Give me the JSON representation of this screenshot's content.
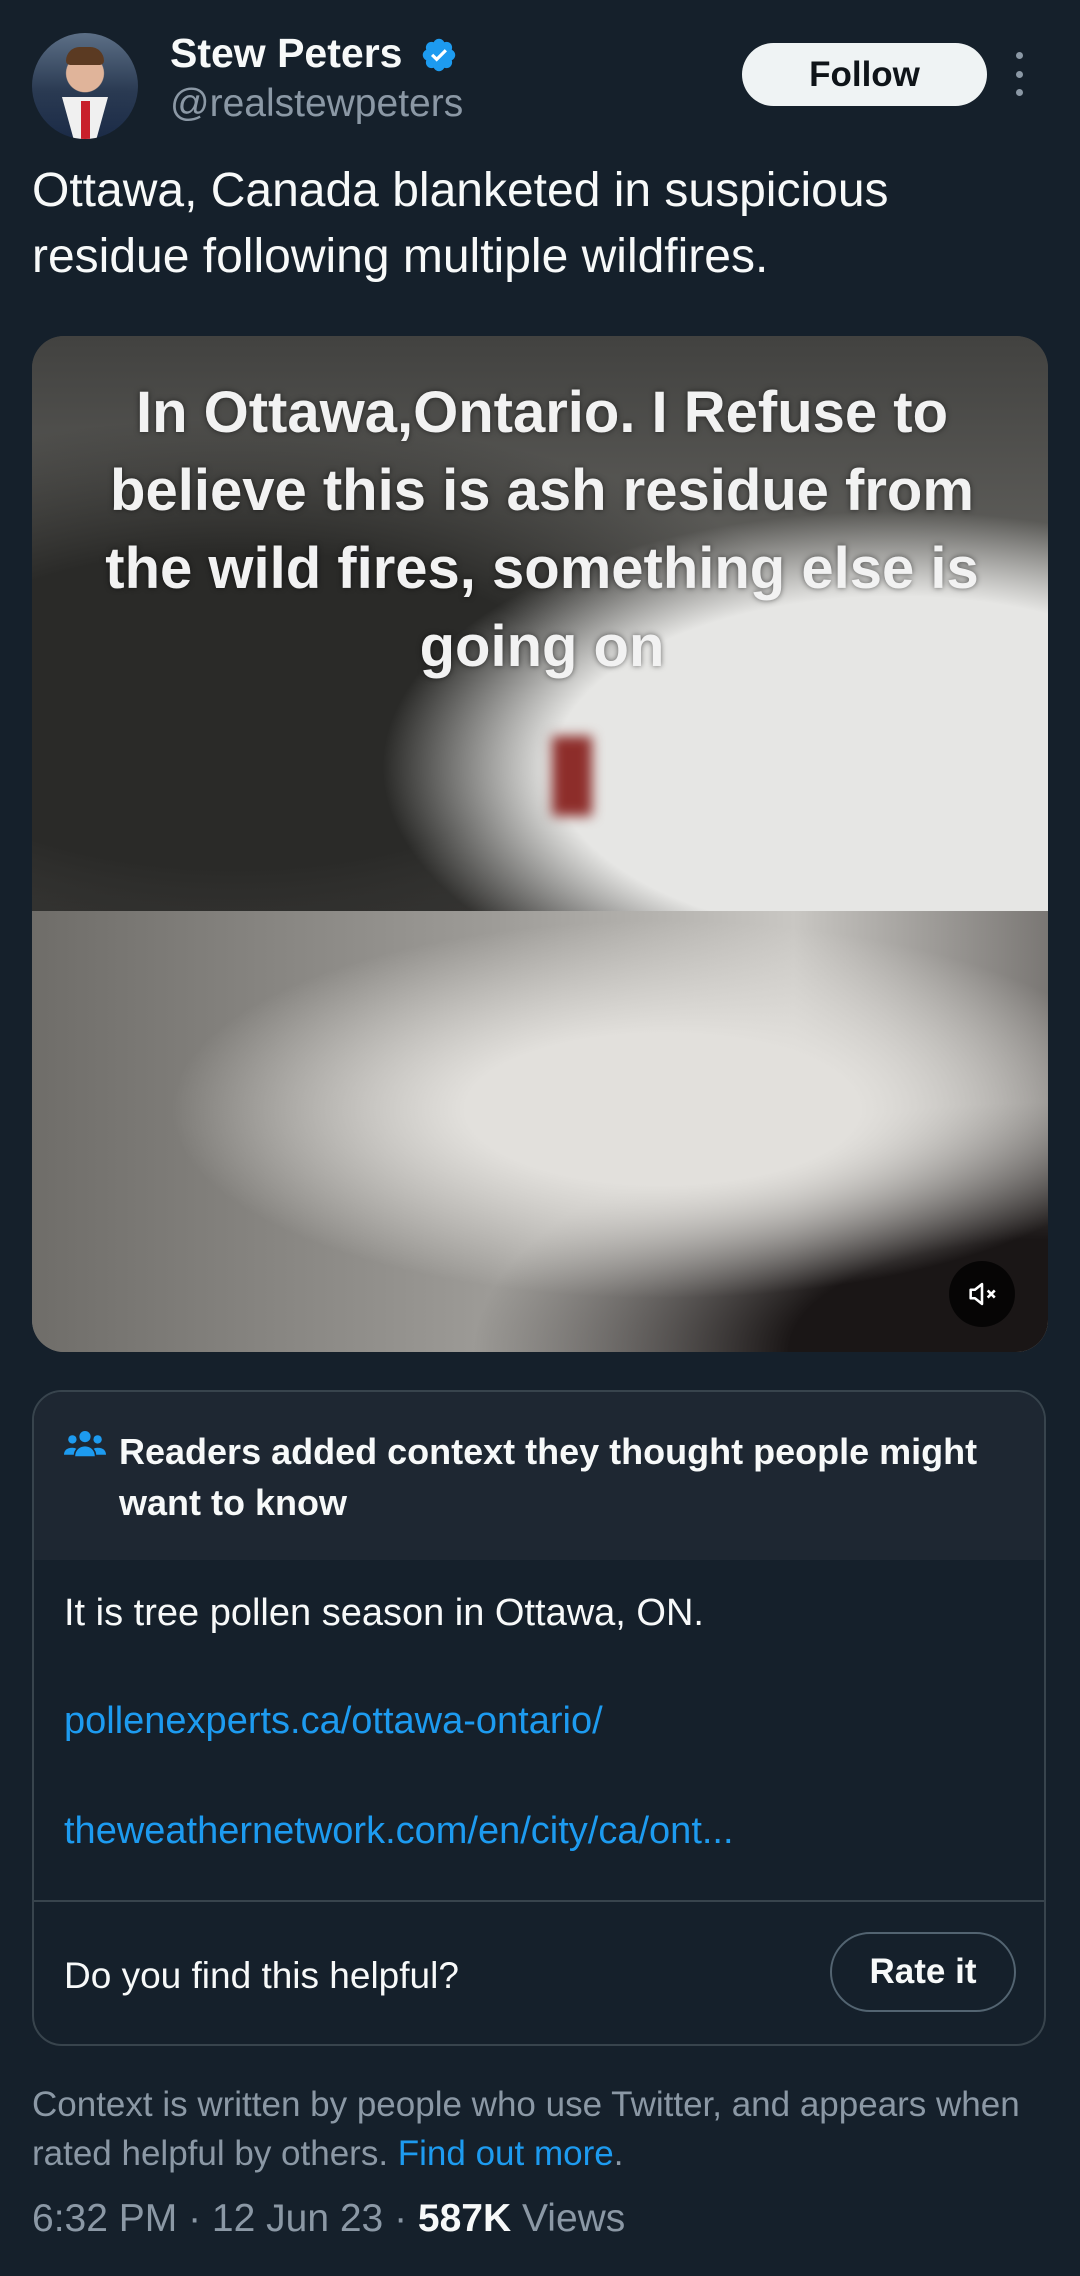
{
  "author": {
    "name": "Stew Peters",
    "handle": "@realstewpeters",
    "verified_icon": "verified-badge-icon"
  },
  "actions": {
    "follow_label": "Follow",
    "more_icon": "more-vertical-icon"
  },
  "tweet": {
    "text": "Ottawa, Canada blanketed in suspicious residue following multiple wildfires."
  },
  "media": {
    "caption": "In Ottawa,Ontario. I Refuse to believe this is ash residue from the wild fires, something else is going on",
    "mute_icon": "speaker-muted-icon"
  },
  "community_note": {
    "icon": "people-group-icon",
    "title": "Readers added context they thought people might want to know",
    "body": "It is tree pollen season in Ottawa, ON.",
    "link1": "pollenexperts.ca/ottawa-ontario/",
    "link2": "theweathernetwork.com/en/city/ca/ont...",
    "question": "Do you find this helpful?",
    "rate_label": "Rate it"
  },
  "context_footer": {
    "text": "Context is written by people who use Twitter, and appears when rated helpful by others. ",
    "link": "Find out more",
    "suffix": "."
  },
  "meta": {
    "time": "6:32 PM",
    "date": "12 Jun 23",
    "separator": " · ",
    "views_count": "587K",
    "views_label": " Views"
  },
  "colors": {
    "background": "#15202b",
    "accent": "#1d9bf0",
    "secondary_text": "#8b98a5",
    "border": "#38444d"
  }
}
